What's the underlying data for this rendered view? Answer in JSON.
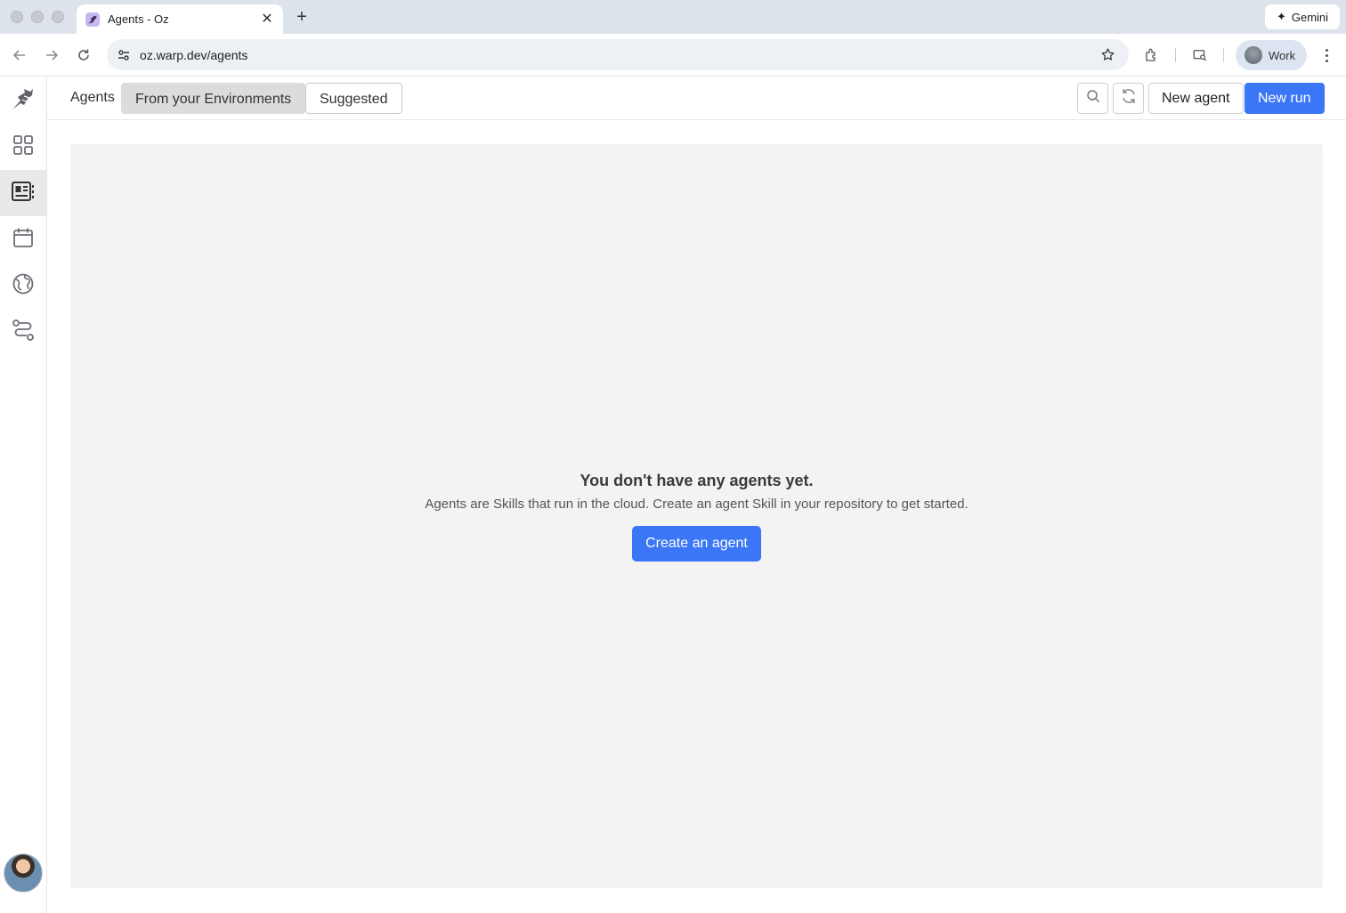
{
  "browser": {
    "tab": {
      "title": "Agents - Oz",
      "close_glyph": "✕"
    },
    "new_tab_glyph": "+",
    "gemini": {
      "label": "Gemini",
      "icon": "sparkle-icon"
    },
    "url": "oz.warp.dev/agents",
    "profile": {
      "label": "Work"
    }
  },
  "sidebar": {
    "items": [
      {
        "name": "oz-logo",
        "icon": "oz-logo-icon"
      },
      {
        "name": "dashboard",
        "icon": "grid-icon"
      },
      {
        "name": "agents",
        "icon": "agents-icon",
        "active": true
      },
      {
        "name": "schedules",
        "icon": "calendar-icon"
      },
      {
        "name": "environments",
        "icon": "globe-icon"
      },
      {
        "name": "integrations",
        "icon": "route-icon"
      }
    ]
  },
  "header": {
    "label": "Agents",
    "tabs": [
      {
        "label": "From your Environments",
        "selected": true
      },
      {
        "label": "Suggested",
        "selected": false
      }
    ],
    "new_agent": "New agent",
    "new_run": "New run"
  },
  "empty_state": {
    "title": "You don't have any agents yet.",
    "description": "Agents are Skills that run in the cloud. Create an agent Skill in your repository to get started.",
    "button": "Create an agent"
  },
  "colors": {
    "primary": "#3b76f6",
    "panel_bg": "#f3f3f3",
    "tabstrip_bg": "#dde3ea"
  }
}
